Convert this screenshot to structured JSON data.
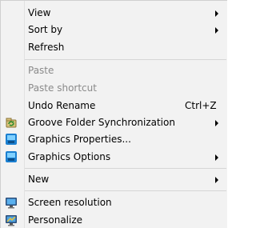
{
  "context_menu": {
    "items": [
      {
        "label": "View",
        "has_submenu": true
      },
      {
        "label": "Sort by",
        "has_submenu": true
      },
      {
        "label": "Refresh"
      },
      {
        "label": "Paste",
        "disabled": true
      },
      {
        "label": "Paste shortcut",
        "disabled": true
      },
      {
        "label": "Undo Rename",
        "shortcut": "Ctrl+Z"
      },
      {
        "label": "Groove Folder Synchronization",
        "icon": "groove-sync-icon",
        "has_submenu": true
      },
      {
        "label": "Graphics Properties...",
        "icon": "intel-graphics-icon"
      },
      {
        "label": "Graphics Options",
        "icon": "intel-graphics-icon",
        "has_submenu": true
      },
      {
        "label": "New",
        "has_submenu": true
      },
      {
        "label": "Screen resolution",
        "icon": "monitor-icon"
      },
      {
        "label": "Personalize",
        "icon": "personalize-monitor-icon"
      }
    ]
  },
  "colors": {
    "menu_background": "#f2f2f2",
    "disabled_text": "#8a8a8a",
    "separator": "#d6d6d6"
  }
}
